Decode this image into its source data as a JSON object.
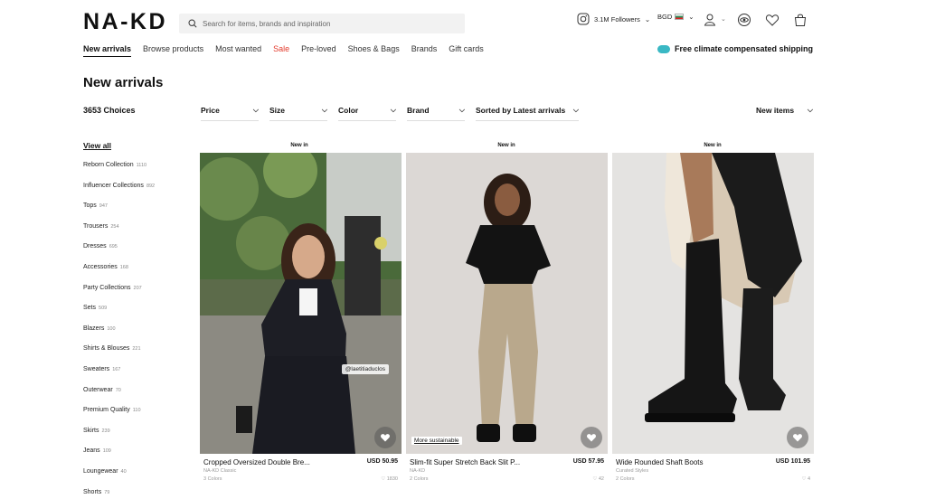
{
  "header": {
    "logo": "NA-KD",
    "search_placeholder": "Search for items, brands and inspiration",
    "followers": "3.1M Followers",
    "currency": "BGD"
  },
  "nav": {
    "items": [
      "New arrivals",
      "Browse products",
      "Most wanted",
      "Sale",
      "Pre-loved",
      "Shoes & Bags",
      "Brands",
      "Gift cards"
    ],
    "shipping": "Free climate compensated shipping"
  },
  "page": {
    "title": "New arrivals",
    "choices": "3653 Choices"
  },
  "filters": {
    "price": "Price",
    "size": "Size",
    "color": "Color",
    "brand": "Brand",
    "sort": "Sorted by Latest arrivals",
    "view": "New items"
  },
  "sidebar": {
    "view_all": "View all",
    "items": [
      {
        "label": "Reborn Collection",
        "count": "1110"
      },
      {
        "label": "Influencer Collections",
        "count": "892"
      },
      {
        "label": "Tops",
        "count": "947"
      },
      {
        "label": "Trousers",
        "count": "254"
      },
      {
        "label": "Dresses",
        "count": "695"
      },
      {
        "label": "Accessories",
        "count": "168"
      },
      {
        "label": "Party Collections",
        "count": "207"
      },
      {
        "label": "Sets",
        "count": "509"
      },
      {
        "label": "Blazers",
        "count": "100"
      },
      {
        "label": "Shirts & Blouses",
        "count": "221"
      },
      {
        "label": "Sweaters",
        "count": "167"
      },
      {
        "label": "Outerwear",
        "count": "70"
      },
      {
        "label": "Premium Quality",
        "count": "110"
      },
      {
        "label": "Skirts",
        "count": "239"
      },
      {
        "label": "Jeans",
        "count": "109"
      },
      {
        "label": "Loungewear",
        "count": "40"
      },
      {
        "label": "Shorts",
        "count": "79"
      }
    ]
  },
  "products": [
    {
      "badge": "New in",
      "name": "Cropped Oversized Double Bre...",
      "price": "USD 50.95",
      "brand": "NA-KD Classic",
      "colors": "3 Colors",
      "likes": "1830",
      "overlay": "@laetitiaduclos"
    },
    {
      "badge": "New in",
      "name": "Slim-fit Super Stretch Back Slit P...",
      "price": "USD 57.95",
      "brand": "NA-KD",
      "colors": "2 Colors",
      "likes": "42",
      "overlay": "More sustainable"
    },
    {
      "badge": "New in",
      "name": "Wide Rounded Shaft Boots",
      "price": "USD 101.95",
      "brand": "Curated Styles",
      "colors": "2 Colors",
      "likes": "4"
    }
  ],
  "icons": [
    "search-icon",
    "instagram-icon",
    "flag-icon",
    "user-icon",
    "chevron-down-icon",
    "eye-icon",
    "heart-icon",
    "bag-icon",
    "cloud-icon"
  ]
}
